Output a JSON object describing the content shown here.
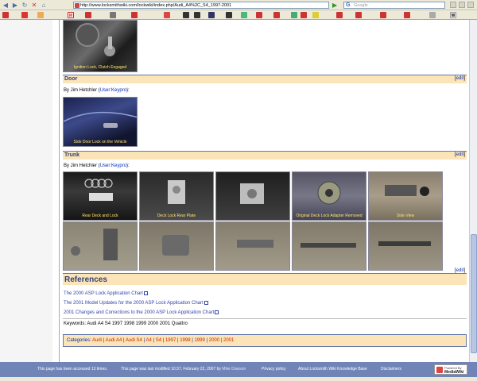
{
  "browser": {
    "url": "http://www.locksmithwiki.com/lockwiki/index.php/Audi_A4%2C_S4_1997-2001",
    "search_placeholder": "Google"
  },
  "sections": {
    "door": {
      "title": "Door",
      "edit": "edit",
      "byline_prefix": "By Jim Hetchler (",
      "byline_link": "User:Keypro",
      "byline_suffix": "):"
    },
    "trunk": {
      "title": "Trunk",
      "edit": "edit",
      "byline_prefix": "By Jim Hetchler (",
      "byline_link": "User:Keypro",
      "byline_suffix": "):"
    }
  },
  "images": {
    "top_caption": "Ignition Lock, Clutch Engaged",
    "door_caption": "Side Door Lock on the Vehicle",
    "trunk_row1": [
      "Rear Deck and Lock",
      "Deck Lock Rear Plate",
      "",
      "Original Deck Lock Adapter Removed",
      "Side View"
    ],
    "trunk_row2": [
      "",
      "",
      "",
      "",
      ""
    ]
  },
  "references": {
    "title": "References",
    "edit": "edit",
    "links": [
      "The 2000 ASP Lock Application Chart",
      "The 2001 Model Updates for the 2000 ASP Lock Application Chart",
      "2001 Changes and Corrections to the 2000 ASP Lock Application Chart"
    ]
  },
  "keywords": "Keywords: Audi A4 S4 1997 1998 1999 2000 2001 Quattro",
  "categories": {
    "label": "Categories:",
    "items": [
      "Audi",
      "Audi A4",
      "Audi S4",
      "A4",
      "S4",
      "1997",
      "1998",
      "1999",
      "2000",
      "2001"
    ]
  },
  "footer": {
    "accessed": "This page has been accessed 13 times.",
    "modified": "This page was last modified 10:37, February 22, 2007 by",
    "modified_by": "Mike Dawson",
    "privacy": "Privacy policy",
    "about": "About Locksmith Wiki Knowledge Base",
    "disclaimers": "Disclaimers",
    "badge_line1": "Powered By",
    "badge_line2": "MediaWiki"
  },
  "colors": {
    "section_bg": "#fbe4b7",
    "link": "#002bb8",
    "footer_bg": "#7084b8"
  }
}
